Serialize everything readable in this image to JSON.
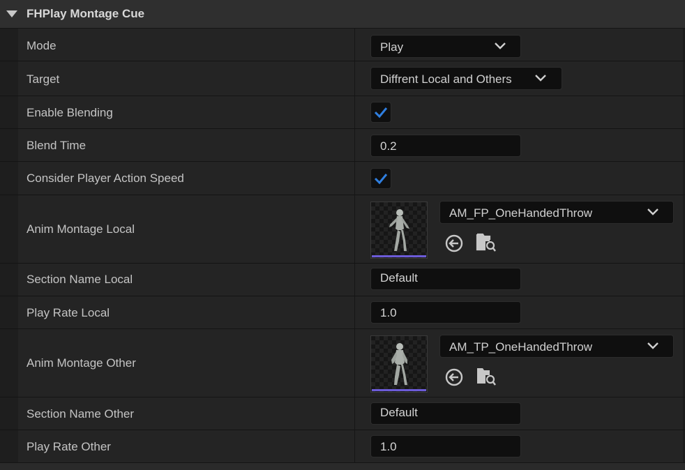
{
  "section": {
    "title": "FHPlay Montage Cue"
  },
  "colors": {
    "accent_check": "#2f7fe0",
    "thumbnail_bar": "#6c5bd8",
    "field_bg": "#0f0f0f",
    "row_bg": "#242424"
  },
  "rows": {
    "mode": {
      "label": "Mode",
      "value": "Play"
    },
    "target": {
      "label": "Target",
      "value": "Diffrent Local and Others"
    },
    "enable_blending": {
      "label": "Enable Blending",
      "checked": true
    },
    "blend_time": {
      "label": "Blend Time",
      "value": "0.2"
    },
    "consider_speed": {
      "label": "Consider Player Action Speed",
      "checked": true
    },
    "anim_local": {
      "label": "Anim Montage Local",
      "asset": "AM_FP_OneHandedThrow",
      "icons": [
        "browse-back-icon",
        "find-in-browser-icon"
      ]
    },
    "section_local": {
      "label": "Section Name Local",
      "value": "Default"
    },
    "rate_local": {
      "label": "Play Rate Local",
      "value": "1.0"
    },
    "anim_other": {
      "label": "Anim Montage Other",
      "asset": "AM_TP_OneHandedThrow",
      "icons": [
        "browse-back-icon",
        "find-in-browser-icon"
      ]
    },
    "section_other": {
      "label": "Section Name Other",
      "value": "Default"
    },
    "rate_other": {
      "label": "Play Rate Other",
      "value": "1.0"
    }
  }
}
